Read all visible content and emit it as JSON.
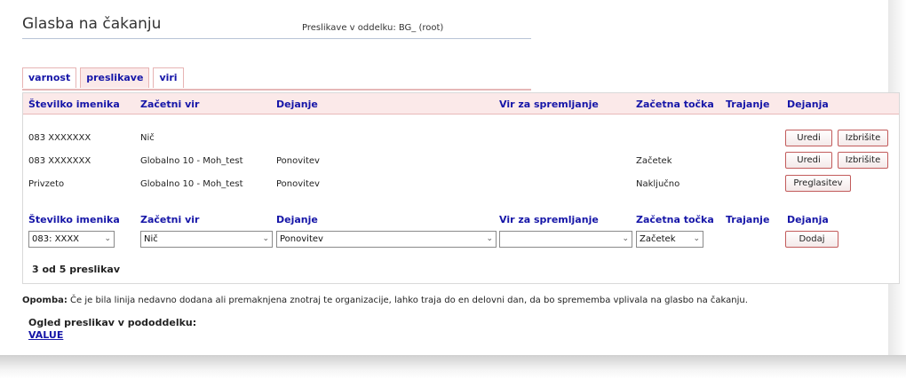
{
  "header": {
    "title": "Glasba na čakanju",
    "subtitle": "Preslikave v oddelku: BG_  (root)"
  },
  "tabs": [
    {
      "label": "varnost",
      "active": false
    },
    {
      "label": "preslikave",
      "active": true
    },
    {
      "label": "viri",
      "active": false
    }
  ],
  "table": {
    "columns": [
      "Številko imenika",
      "Začetni vir",
      "Dejanje",
      "Vir za spremljanje",
      "Začetna točka",
      "Trajanje",
      "Dejanja"
    ],
    "rows": [
      {
        "number": "083 XXXXXXX",
        "source": "Nič",
        "action": "",
        "monitor": "",
        "start": "",
        "duration": "",
        "buttons": [
          "Uredi",
          "Izbrišite"
        ]
      },
      {
        "number": "083 XXXXXXX",
        "source": "Globalno 10 - Moh_test",
        "action": "Ponovitev",
        "monitor": "",
        "start": "Začetek",
        "duration": "",
        "buttons": [
          "Uredi",
          "Izbrišite"
        ]
      },
      {
        "number": "Privzeto",
        "source": "Globalno 10 - Moh_test",
        "action": "Ponovitev",
        "monitor": "",
        "start": "Naključno",
        "duration": "",
        "buttons": [
          "Preglasitev"
        ]
      }
    ]
  },
  "add_form": {
    "columns": [
      "Številko imenika",
      "Začetni vir",
      "Dejanje",
      "Vir za spremljanje",
      "Začetna točka",
      "Trajanje",
      "Dejanja"
    ],
    "number_value": "083: XXXX",
    "source_value": "Nič",
    "action_value": "Ponovitev",
    "monitor_value": "",
    "start_value": "Začetek",
    "add_button": "Dodaj"
  },
  "count_text": "3 od 5 preslikav",
  "note": {
    "label": "Opomba:",
    "text": " Če je bila linija nedavno dodana ali premaknjena znotraj te organizacije, lahko traja do en delovni dan, da bo sprememba vplivala na glasbo na čakanju."
  },
  "subdept": {
    "heading": "Ogled preslikav v pododdelku:",
    "link": "VALUE"
  },
  "icons": {
    "dropdown": "chevron-down-icon"
  },
  "colors": {
    "accent": "#1616a8",
    "tab_bg": "#fbe9e9",
    "border": "#e6b7b7",
    "button_border": "#c25b5b"
  }
}
